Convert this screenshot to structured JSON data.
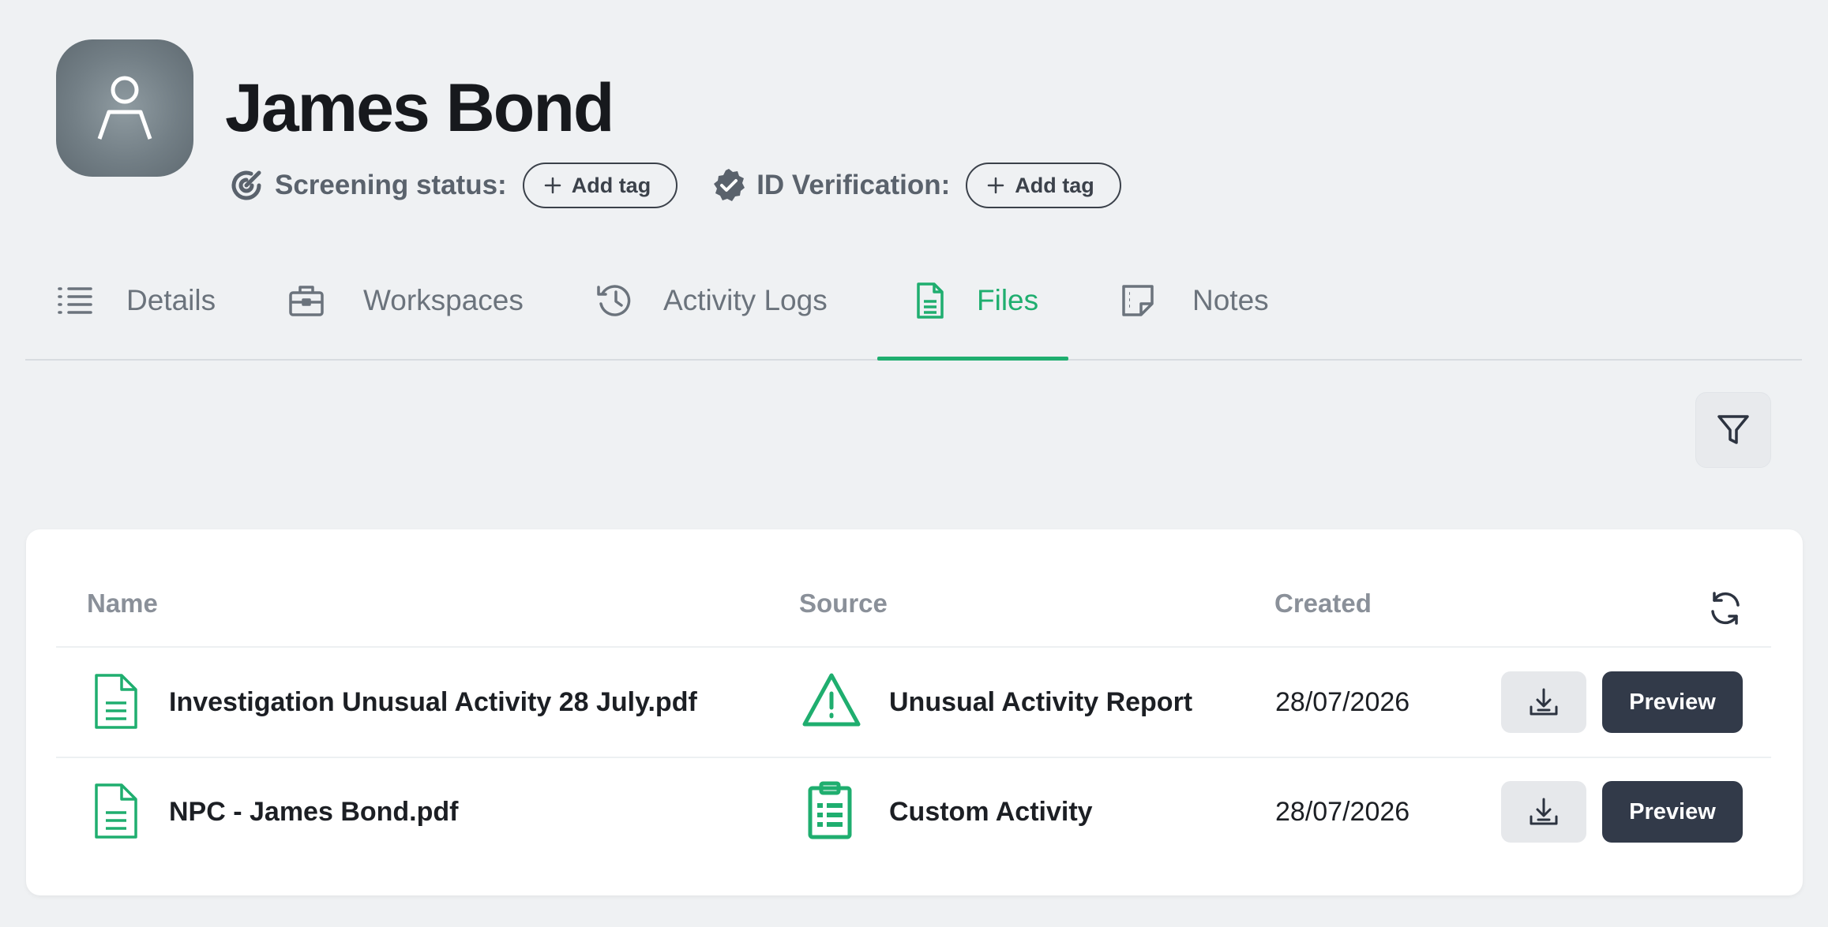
{
  "profile": {
    "name": "James Bond",
    "avatar_icon": "user-icon"
  },
  "status": {
    "screening_label": "Screening status:",
    "screening_add_tag": "Add tag",
    "id_verification_label": "ID Verification:",
    "id_add_tag": "Add tag"
  },
  "tabs": [
    {
      "label": "Details",
      "icon": "list-icon"
    },
    {
      "label": "Workspaces",
      "icon": "briefcase-icon"
    },
    {
      "label": "Activity Logs",
      "icon": "history-icon"
    },
    {
      "label": "Files",
      "icon": "file-icon",
      "active": true
    },
    {
      "label": "Notes",
      "icon": "sticky-note-icon"
    }
  ],
  "table": {
    "columns": [
      "Name",
      "Source",
      "Created"
    ],
    "rows": [
      {
        "name": "Investigation Unusual Activity 28 July.pdf",
        "source": "Unusual Activity Report",
        "source_icon": "warning-triangle-icon",
        "created": "28/07/2026",
        "preview_label": "Preview"
      },
      {
        "name": "NPC - James Bond.pdf",
        "source": "Custom Activity",
        "source_icon": "clipboard-list-icon",
        "created": "28/07/2026",
        "preview_label": "Preview"
      }
    ]
  },
  "colors": {
    "accent": "#1fae6f",
    "background": "#eff1f3",
    "dark_button": "#323a49"
  }
}
